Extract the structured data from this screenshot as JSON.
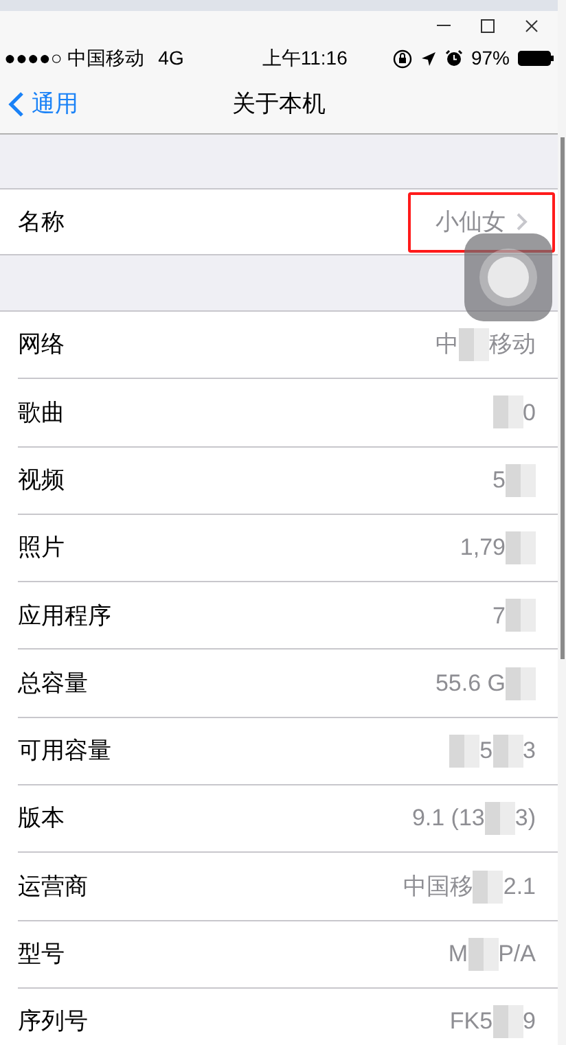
{
  "status_bar": {
    "carrier": "●●●●○ 中国移动",
    "network": "4G",
    "time": "上午11:16",
    "battery": "97%"
  },
  "nav": {
    "back": "通用",
    "title": "关于本机"
  },
  "name_row": {
    "label": "名称",
    "value": "小仙女",
    "highlighted": true
  },
  "rows": [
    {
      "label": "网络",
      "parts": [
        {
          "kind": "text",
          "text": "中"
        },
        {
          "kind": "mosaic"
        },
        {
          "kind": "text",
          "text": "移动"
        }
      ]
    },
    {
      "label": "歌曲",
      "parts": [
        {
          "kind": "mosaic"
        },
        {
          "kind": "text",
          "text": "0"
        }
      ]
    },
    {
      "label": "视频",
      "parts": [
        {
          "kind": "text",
          "text": "5"
        },
        {
          "kind": "mosaic"
        }
      ]
    },
    {
      "label": "照片",
      "parts": [
        {
          "kind": "text",
          "text": "1,79"
        },
        {
          "kind": "mosaic"
        }
      ]
    },
    {
      "label": "应用程序",
      "parts": [
        {
          "kind": "text",
          "text": "7"
        },
        {
          "kind": "mosaic"
        }
      ]
    },
    {
      "label": "总容量",
      "parts": [
        {
          "kind": "text",
          "text": "55.6 G"
        },
        {
          "kind": "mosaic"
        }
      ]
    },
    {
      "label": "可用容量",
      "parts": [
        {
          "kind": "mosaic"
        },
        {
          "kind": "text",
          "text": "5"
        },
        {
          "kind": "mosaic"
        },
        {
          "kind": "text",
          "text": "3"
        }
      ]
    },
    {
      "label": "版本",
      "parts": [
        {
          "kind": "text",
          "text": "9.1 (13"
        },
        {
          "kind": "mosaic"
        },
        {
          "kind": "text",
          "text": "3)"
        }
      ]
    },
    {
      "label": "运营商",
      "parts": [
        {
          "kind": "text",
          "text": "中国移"
        },
        {
          "kind": "mosaic"
        },
        {
          "kind": "text",
          "text": "2.1"
        }
      ]
    },
    {
      "label": "型号",
      "parts": [
        {
          "kind": "text",
          "text": "M"
        },
        {
          "kind": "mosaic"
        },
        {
          "kind": "text",
          "text": "P/A"
        }
      ]
    },
    {
      "label": "序列号",
      "parts": [
        {
          "kind": "text",
          "text": "FK5"
        },
        {
          "kind": "mosaic"
        },
        {
          "kind": "text",
          "text": "9"
        }
      ]
    }
  ]
}
